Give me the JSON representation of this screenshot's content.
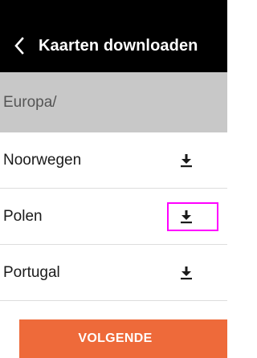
{
  "header": {
    "title": "Kaarten downloaden",
    "back_icon": "chevron-left-icon"
  },
  "breadcrumb": "Europa/",
  "countries": [
    {
      "name": "Noorwegen",
      "icon": "download-icon"
    },
    {
      "name": "Polen",
      "icon": "download-icon",
      "highlighted": true
    },
    {
      "name": "Portugal",
      "icon": "download-icon"
    }
  ],
  "footer": {
    "next_label": "VOLGENDE"
  },
  "colors": {
    "header_bg": "#000000",
    "breadcrumb_bg": "#c8c8c8",
    "accent": "#ee6a3a",
    "highlight": "#ff00ff"
  }
}
